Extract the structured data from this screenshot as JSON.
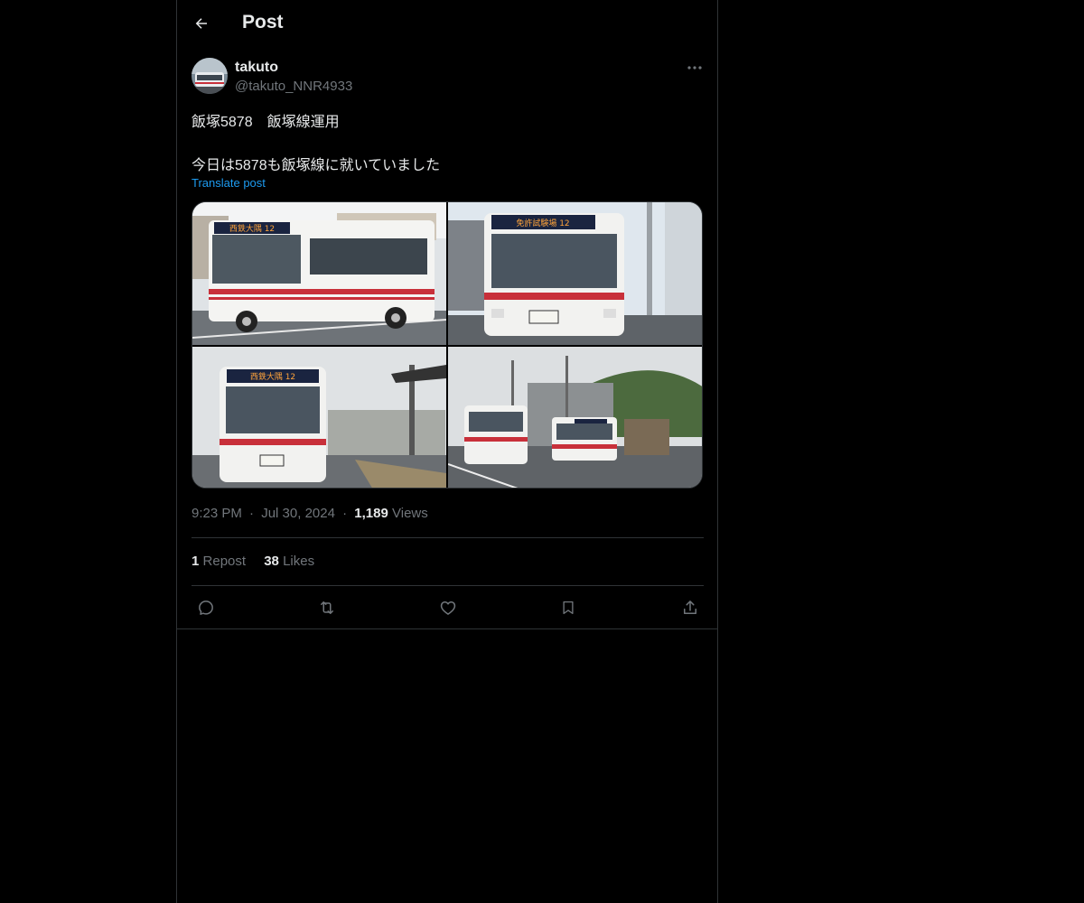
{
  "header": {
    "title": "Post"
  },
  "author": {
    "name": "takuto",
    "handle": "@takuto_NNR4933"
  },
  "post": {
    "line1": "飯塚5878　飯塚線運用",
    "line2": "今日は5878も飯塚線に就いていました",
    "translate_label": "Translate post",
    "photos": [
      {
        "dest_sign": "西鉄大隅 12"
      },
      {
        "dest_sign": "免許試験場 12"
      },
      {
        "dest_sign": "西鉄大隅 12"
      },
      {
        "dest_sign": ""
      }
    ],
    "time": "9:23 PM",
    "date": "Jul 30, 2024",
    "views_count": "1,189",
    "views_label": "Views",
    "separator": "·"
  },
  "stats": {
    "reposts_count": "1",
    "reposts_label": "Repost",
    "likes_count": "38",
    "likes_label": "Likes"
  },
  "icons": {
    "back": "arrow-left-icon",
    "more": "more-dots-icon",
    "reply": "reply-icon",
    "repost": "repost-icon",
    "like": "heart-icon",
    "bookmark": "bookmark-icon",
    "share": "share-icon"
  },
  "colors": {
    "background": "#000000",
    "text": "#e7e9ea",
    "muted": "#71767b",
    "link": "#1d9bf0",
    "border": "#2f3336"
  }
}
